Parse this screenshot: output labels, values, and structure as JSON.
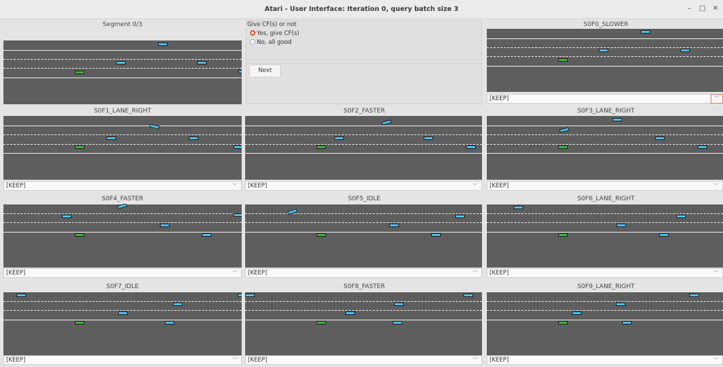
{
  "window": {
    "title": "Atari - User Interface: Iteration 0, query batch size 3",
    "controls": [
      "–",
      "□",
      "✕"
    ]
  },
  "segment_label": "Segment 0/3",
  "cf_group": {
    "title": "Give CF(s) or not",
    "option_yes": "Yes, give CF(s)",
    "option_no": "No, all good",
    "selected": "yes"
  },
  "next_button": "Next",
  "colors": {
    "ego_car": "#3fb83f",
    "other_car": "#4fc0f0",
    "road": "#5e5e5e",
    "accent": "#e95420"
  },
  "cells": [
    {
      "label": "S0F0_SLOWER",
      "select": "[KEEP]"
    },
    {
      "label": "S0F1_LANE_RIGHT",
      "select": "[KEEP]"
    },
    {
      "label": "S0F2_FASTER",
      "select": "[KEEP]"
    },
    {
      "label": "S0F3_LANE_RIGHT",
      "select": "[KEEP]"
    },
    {
      "label": "S0F4_FASTER",
      "select": "[KEEP]"
    },
    {
      "label": "S0F5_IDLE",
      "select": "[KEEP]"
    },
    {
      "label": "S0F6_LANE_RIGHT",
      "select": "[KEEP]"
    },
    {
      "label": "S0F7_IDLE",
      "select": "[KEEP]"
    },
    {
      "label": "S0F8_FASTER",
      "select": "[KEEP]"
    },
    {
      "label": "S0F9_LANE_RIGHT",
      "select": "[KEEP]"
    }
  ]
}
